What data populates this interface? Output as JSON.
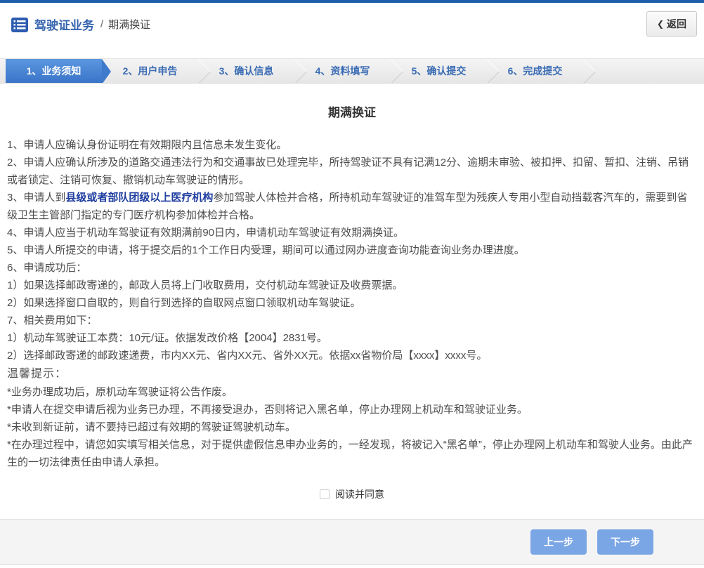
{
  "header": {
    "title": "驾驶证业务",
    "separator": "/",
    "subtitle": "期满换证",
    "back_chevron": "❮",
    "back_label": "返回"
  },
  "steps": [
    {
      "label": "1、业务须知",
      "active": true
    },
    {
      "label": "2、用户申告",
      "active": false
    },
    {
      "label": "3、确认信息",
      "active": false
    },
    {
      "label": "4、资料填写",
      "active": false
    },
    {
      "label": "5、确认提交",
      "active": false
    },
    {
      "label": "6、完成提交",
      "active": false
    }
  ],
  "content": {
    "title": "期满换证",
    "p1": "1、申请人应确认身份证明在有效期限内且信息未发生变化。",
    "p2": "2、申请人应确认所涉及的道路交通违法行为和交通事故已处理完毕，所持驾驶证不具有记满12分、逾期未审验、被扣押、扣留、暂扣、注销、吊销或者锁定、注销可恢复、撤销机动车驾驶证的情形。",
    "p3_prefix": "3、申请人到",
    "p3_highlight": "县级或者部队团级以上医疗机构",
    "p3_suffix": "参加驾驶人体检并合格，所持机动车驾驶证的准驾车型为残疾人专用小型自动挡载客汽车的，需要到省级卫生主管部门指定的专门医疗机构参加体检并合格。",
    "p4": "4、申请人应当于机动车驾驶证有效期满前90日内，申请机动车驾驶证有效期满换证。",
    "p5": "5、申请人所提交的申请，将于提交后的1个工作日内受理，期间可以通过网办进度查询功能查询业务办理进度。",
    "p6": "6、申请成功后：",
    "p6_1": "1）如果选择邮政寄递的，邮政人员将上门收取费用，交付机动车驾驶证及收费票据。",
    "p6_2": "2）如果选择窗口自取的，则自行到选择的自取网点窗口领取机动车驾驶证。",
    "p7": "7、相关费用如下：",
    "p7_1": "1）机动车驾驶证工本费：10元/证。依据发改价格【2004】2831号。",
    "p7_2": "2）选择邮政寄递的邮政速递费，市内XX元、省内XX元、省外XX元。依据xx省物价局【xxxx】xxxx号。",
    "tips_title": "温馨提示：",
    "tip1": "*业务办理成功后，原机动车驾驶证将公告作废。",
    "tip2": "*申请人在提交申请后视为业务已办理，不再接受退办，否则将记入黑名单，停止办理网上机动车和驾驶证业务。",
    "tip3": "*未收到新证前，请不要持已超过有效期的驾驶证驾驶机动车。",
    "tip4": "*在办理过程中，请您如实填写相关信息，对于提供虚假信息申办业务的，一经发现，将被记入“黑名单”，停止办理网上机动车和驾驶人业务。由此产生的一切法律责任由申请人承担。"
  },
  "agreement": {
    "label": "阅读并同意",
    "checked": false
  },
  "footer": {
    "prev_label": "上一步",
    "next_label": "下一步"
  },
  "colors": {
    "top_line": "#1c5ea9",
    "active_tab": "#4080d5",
    "tab_text": "#3a6cb4",
    "highlight_link": "#1f3da0",
    "button_blue": "#7ba6e5"
  }
}
